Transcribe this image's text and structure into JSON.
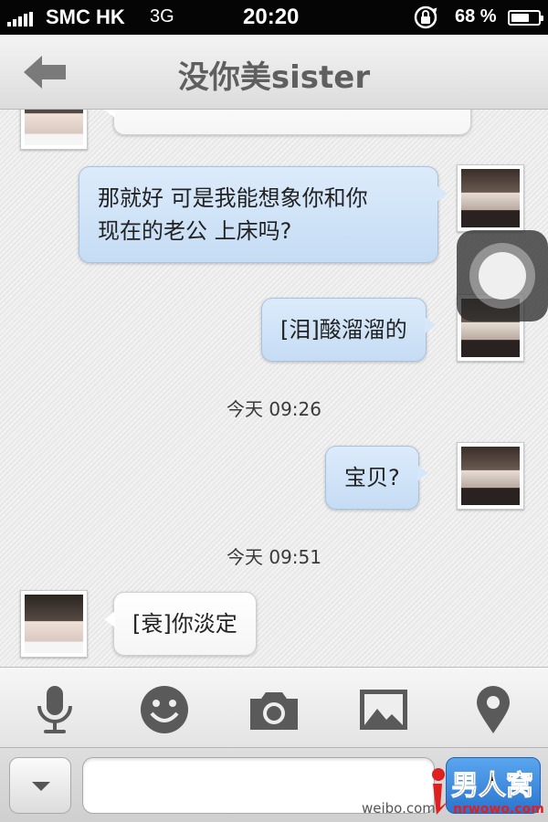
{
  "status_bar": {
    "carrier": "SMC HK",
    "network": "3G",
    "time": "20:20",
    "battery_percent": "68 %",
    "battery_level": 0.68
  },
  "nav": {
    "title": "没你美sister",
    "back_icon": "back-arrow-icon"
  },
  "messages": [
    {
      "id": "m0",
      "side": "in",
      "text": ""
    },
    {
      "id": "m1",
      "side": "out",
      "lines": [
        "那就好 可是我能想象你和你",
        "现在的老公 上床吗?"
      ]
    },
    {
      "id": "m2",
      "side": "out",
      "text": "[泪]酸溜溜的"
    },
    {
      "id": "ts1",
      "timestamp": "今天 09:26"
    },
    {
      "id": "m3",
      "side": "out",
      "text": "宝贝?"
    },
    {
      "id": "ts2",
      "timestamp": "今天 09:51"
    },
    {
      "id": "m4",
      "side": "in",
      "text": "[衰]你淡定"
    }
  ],
  "toolbar": {
    "icons": [
      "microphone-icon",
      "emoji-icon",
      "camera-icon",
      "photo-icon",
      "location-icon"
    ]
  },
  "input_bar": {
    "value": "",
    "toggle_icon": "chevron-down-icon"
  },
  "watermark": {
    "url": "weibo.com",
    "logo_text": "男人窝",
    "logo_sub": "nrwowo.com"
  },
  "colors": {
    "outgoing_bubble": "#cfe3f8",
    "incoming_bubble": "#ffffff",
    "status_bar": "#050505",
    "nav_title": "#5f5f5f"
  }
}
